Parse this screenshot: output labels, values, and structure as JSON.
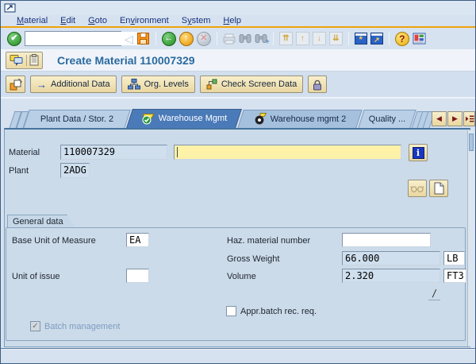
{
  "menubar": {
    "items": [
      {
        "pre": "",
        "key": "M",
        "post": "aterial"
      },
      {
        "pre": "",
        "key": "E",
        "post": "dit"
      },
      {
        "pre": "",
        "key": "G",
        "post": "oto"
      },
      {
        "pre": "En",
        "key": "v",
        "post": "ironment"
      },
      {
        "pre": "S",
        "key": "y",
        "post": "stem"
      },
      {
        "pre": "",
        "key": "H",
        "post": "elp"
      }
    ]
  },
  "toolbar": {
    "command_value": ""
  },
  "title_row": {
    "title": "Create Material 110007329"
  },
  "app_toolbar": {
    "additional_data_label": "Additional Data",
    "org_levels_label": "Org. Levels",
    "check_screen_label": "Check Screen Data"
  },
  "tabs": {
    "items": [
      {
        "label": "Plant Data / Stor. 2"
      },
      {
        "label": "Warehouse Mgmt"
      },
      {
        "label": "Warehouse mgmt 2"
      },
      {
        "label": "Quality ..."
      }
    ]
  },
  "fields": {
    "material": {
      "label": "Material",
      "value": "110007329",
      "description_value": ""
    },
    "plant": {
      "label": "Plant",
      "value": "2ADG"
    },
    "general_data": {
      "title": "General data",
      "base_unit": {
        "label": "Base Unit of Measure",
        "value": "EA"
      },
      "haz_material": {
        "label": "Haz. material number",
        "value": ""
      },
      "gross_weight": {
        "label": "Gross Weight",
        "value": "66.000",
        "unit": "LB"
      },
      "unit_of_issue": {
        "label": "Unit of issue",
        "value": ""
      },
      "volume": {
        "label": "Volume",
        "value": "2.320",
        "unit": "FT3"
      },
      "slash": "/",
      "appr_batch": {
        "label": "Appr.batch rec. req.",
        "checked": false
      },
      "batch_mgmt": {
        "label": "Batch management",
        "checked": true
      }
    }
  },
  "glyphs": {
    "enter": "✔",
    "dropdown": "▤",
    "back_triangle": "◁",
    "nav_back": "←",
    "nav_up": "↑",
    "cancel": "✕",
    "page_first": "⇈",
    "page_prev": "↑",
    "page_next": "↓",
    "page_last": "⇊",
    "session_star": "*",
    "shortcut_arrow": "↗",
    "help": "?",
    "info": "i",
    "add_arrow": "→",
    "tab_prev": "◀",
    "tab_next": "▶",
    "check": "✓"
  },
  "colors": {
    "active_tab": "#4a7ab8",
    "required_field": "#fdf2a8",
    "display_field": "#cfdfee",
    "accent_rule": "#f0a30a",
    "title_text": "#2a6a9e",
    "button_face": "#f2e4b4"
  }
}
